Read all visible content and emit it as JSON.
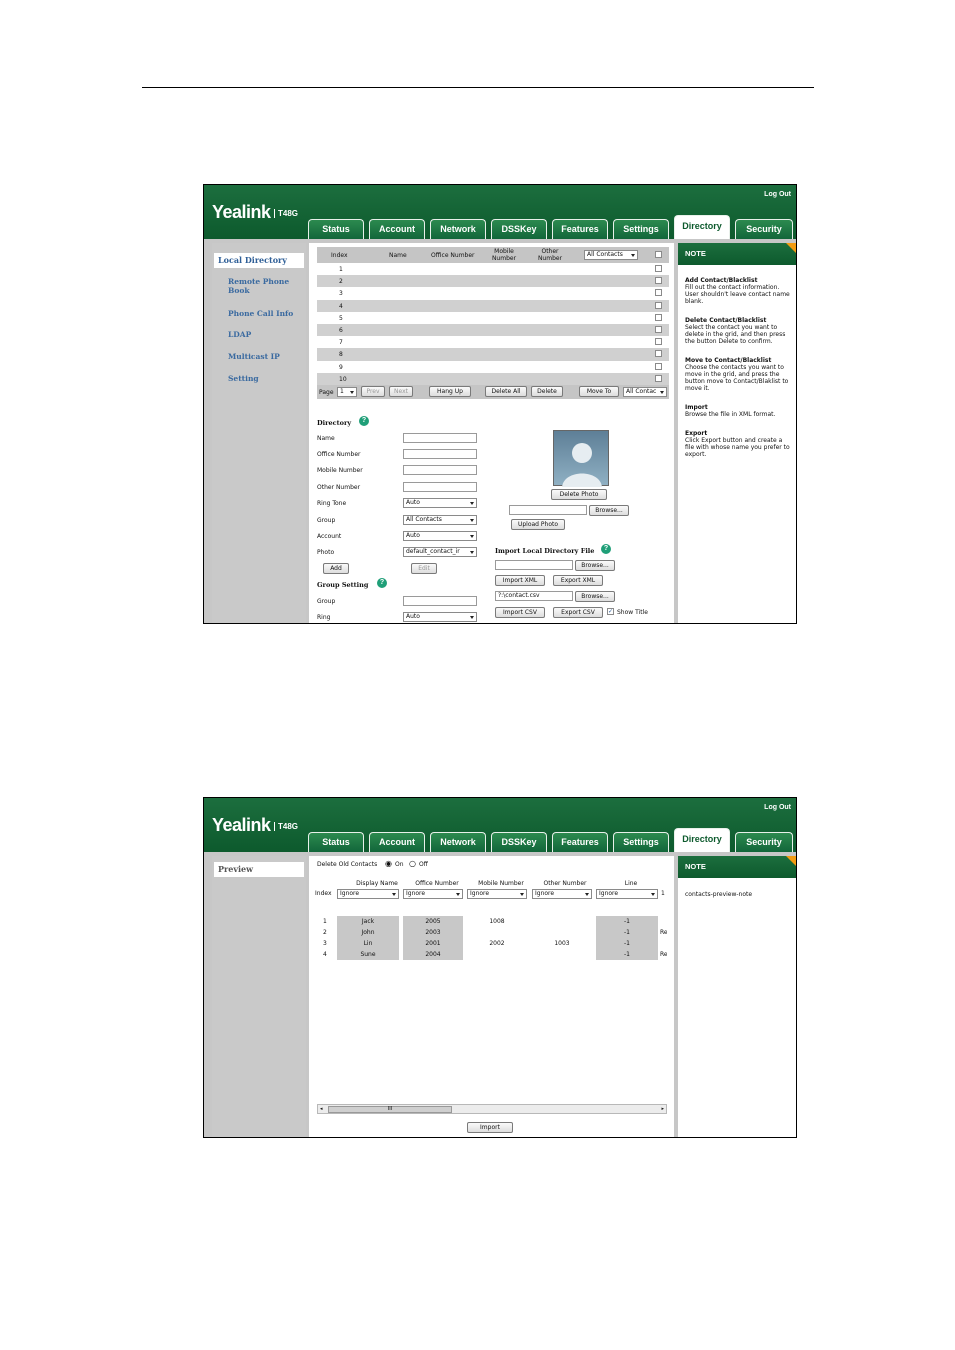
{
  "app": {
    "brand": "Yealink",
    "model": "T48G",
    "logout": "Log Out"
  },
  "tabs": [
    "Status",
    "Account",
    "Network",
    "DSSKey",
    "Features",
    "Settings",
    "Directory",
    "Security"
  ],
  "screen1": {
    "nav": [
      "Local Directory",
      "Remote Phone Book",
      "Phone Call Info",
      "LDAP",
      "Multicast IP",
      "Setting"
    ],
    "grid": {
      "headers": {
        "index": "Index",
        "name": "Name",
        "office": "Office Number",
        "mobile": "Mobile Number",
        "other": "Other Number",
        "filter": "All Contacts"
      },
      "rows": [
        "1",
        "2",
        "3",
        "4",
        "5",
        "6",
        "7",
        "8",
        "9",
        "10"
      ],
      "footer": {
        "page_label": "Page",
        "page": "1",
        "prev": "Prev",
        "next": "Next",
        "hang_up": "Hang Up",
        "delete_all": "Delete All",
        "delete": "Delete",
        "move_to": "Move To",
        "move_target": "All Contac"
      }
    },
    "directory": {
      "title": "Directory",
      "name": "Name",
      "office": "Office Number",
      "mobile": "Mobile Number",
      "other": "Other Number",
      "ring_tone": "Ring Tone",
      "ring_tone_value": "Auto",
      "group": "Group",
      "group_value": "All Contacts",
      "account": "Account",
      "account_value": "Auto",
      "photo": "Photo",
      "photo_value": "default_contact_ir",
      "add": "Add",
      "edit": "Edit",
      "delete_photo": "Delete Photo",
      "browse": "Browse...",
      "upload_photo": "Upload Photo"
    },
    "group_setting": {
      "title": "Group Setting",
      "group": "Group",
      "ring": "Ring",
      "ring_value": "Auto"
    },
    "import": {
      "title": "Import Local Directory File",
      "browse": "Browse...",
      "import_xml": "Import XML",
      "export_xml": "Export XML",
      "csv_path": "?:\\contact.csv",
      "import_csv": "Import CSV",
      "export_csv": "Export CSV",
      "show_title": "Show Title"
    },
    "note": {
      "header": "NOTE",
      "items": [
        {
          "title": "Add Contact/Blacklist",
          "text": "Fill out the contact information. User shouldn't leave contact name blank."
        },
        {
          "title": "Delete Contact/Blacklist",
          "text": "Select the contact you want to delete in the grid, and then press the button Delete to confirm."
        },
        {
          "title": "Move to Contact/Blacklist",
          "text": "Choose the contacts you want to move in the grid, and press the button move to Contact/Blaklist to move it."
        },
        {
          "title": "Import",
          "text": "Browse the file in XML format."
        },
        {
          "title": "Export",
          "text": "Click Export button and create a file with whose name you prefer to export."
        }
      ]
    }
  },
  "screen2": {
    "nav": [
      "Preview"
    ],
    "delete_old": {
      "label": "Delete Old Contacts",
      "on": "On",
      "off": "Off"
    },
    "columns": [
      "Display Name",
      "Office Number",
      "Mobile Number",
      "Other Number",
      "Line"
    ],
    "index_label": "Index",
    "ignore": "Ignore",
    "rows": [
      {
        "index": "1",
        "name": "Jack",
        "office": "2005",
        "mobile": "1008",
        "other": "",
        "line": "-1",
        "extra": ""
      },
      {
        "index": "2",
        "name": "John",
        "office": "2003",
        "mobile": "",
        "other": "",
        "line": "-1",
        "extra": "Re"
      },
      {
        "index": "3",
        "name": "Lin",
        "office": "2001",
        "mobile": "2002",
        "other": "1003",
        "line": "-1",
        "extra": ""
      },
      {
        "index": "4",
        "name": "Sune",
        "office": "2004",
        "mobile": "",
        "other": "",
        "line": "-1",
        "extra": "Re"
      }
    ],
    "scroll_thumb": "III",
    "import": "Import",
    "note": {
      "header": "NOTE",
      "text": "contacts-preview-note"
    }
  }
}
